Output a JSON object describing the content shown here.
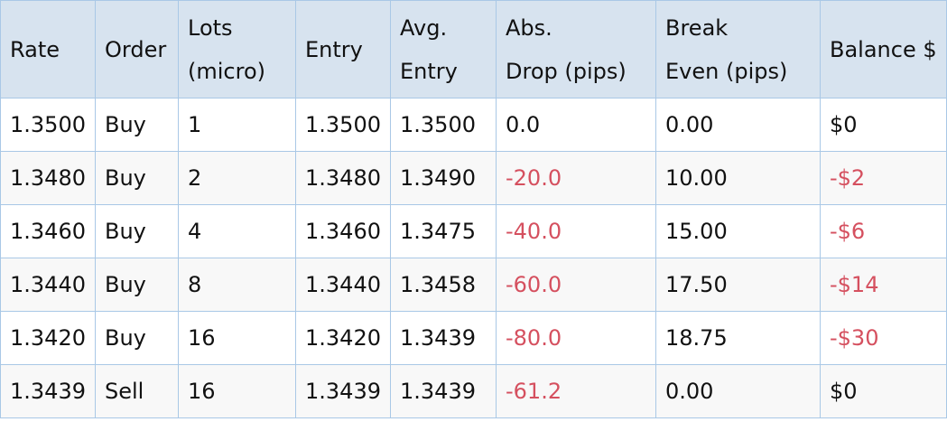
{
  "table": {
    "headers": [
      [
        "Rate"
      ],
      [
        "Order"
      ],
      [
        "Lots",
        "(micro)"
      ],
      [
        "Entry"
      ],
      [
        "Avg.",
        "Entry"
      ],
      [
        "Abs.",
        "Drop (pips)"
      ],
      [
        "Break",
        "Even (pips)"
      ],
      [
        "Balance $"
      ]
    ],
    "rows": [
      [
        "1.3500",
        "Buy",
        "1",
        "1.3500",
        "1.3500",
        "0.0",
        "0.00",
        "$0"
      ],
      [
        "1.3480",
        "Buy",
        "2",
        "1.3480",
        "1.3490",
        "-20.0",
        "10.00",
        "-$2"
      ],
      [
        "1.3460",
        "Buy",
        "4",
        "1.3460",
        "1.3475",
        "-40.0",
        "15.00",
        "-$6"
      ],
      [
        "1.3440",
        "Buy",
        "8",
        "1.3440",
        "1.3458",
        "-60.0",
        "17.50",
        "-$14"
      ],
      [
        "1.3420",
        "Buy",
        "16",
        "1.3420",
        "1.3439",
        "-80.0",
        "18.75",
        "-$30"
      ],
      [
        "1.3439",
        "Sell",
        "16",
        "1.3439",
        "1.3439",
        "-61.2",
        "0.00",
        "$0"
      ]
    ]
  },
  "colors": {
    "header_bg": "#d7e3ef",
    "border": "#a9c8e6",
    "negative_text": "#d5505f",
    "text": "#111111"
  }
}
